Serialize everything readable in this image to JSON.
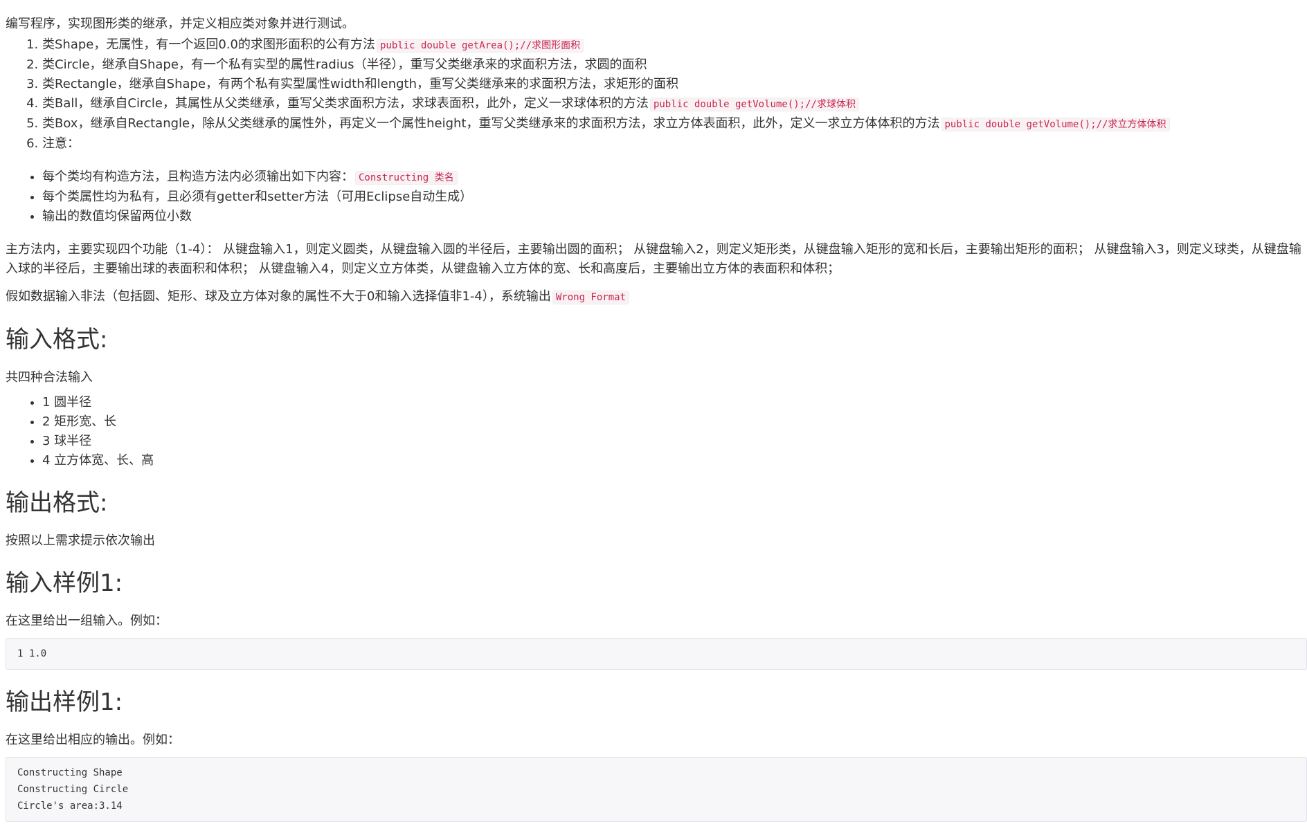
{
  "intro": "编写程序，实现图形类的继承，并定义相应类对象并进行测试。",
  "requirements": [
    {
      "text": "类Shape，无属性，有一个返回0.0的求图形面积的公有方法",
      "code": "public double getArea();//求图形面积"
    },
    {
      "text": "类Circle，继承自Shape，有一个私有实型的属性radius（半径），重写父类继承来的求面积方法，求圆的面积",
      "code": ""
    },
    {
      "text": "类Rectangle，继承自Shape，有两个私有实型属性width和length，重写父类继承来的求面积方法，求矩形的面积",
      "code": ""
    },
    {
      "text": "类Ball，继承自Circle，其属性从父类继承，重写父类求面积方法，求球表面积，此外，定义一求球体积的方法",
      "code": "public double getVolume();//求球体积"
    },
    {
      "text": "类Box，继承自Rectangle，除从父类继承的属性外，再定义一个属性height，重写父类继承来的求面积方法，求立方体表面积，此外，定义一求立方体体积的方法",
      "code": "public double getVolume();//求立方体体积"
    },
    {
      "text": "注意：",
      "code": ""
    }
  ],
  "notes": [
    {
      "text": "每个类均有构造方法，且构造方法内必须输出如下内容：",
      "code": "Constructing 类名"
    },
    {
      "text": "每个类属性均为私有，且必须有getter和setter方法（可用Eclipse自动生成）",
      "code": ""
    },
    {
      "text": "输出的数值均保留两位小数",
      "code": ""
    }
  ],
  "main_paragraph": "主方法内，主要实现四个功能（1-4）： 从键盘输入1，则定义圆类，从键盘输入圆的半径后，主要输出圆的面积； 从键盘输入2，则定义矩形类，从键盘输入矩形的宽和长后，主要输出矩形的面积； 从键盘输入3，则定义球类，从键盘输入球的半径后，主要输出球的表面积和体积； 从键盘输入4，则定义立方体类，从键盘输入立方体的宽、长和高度后，主要输出立方体的表面积和体积；",
  "wrong_paragraph": {
    "text": "假如数据输入非法（包括圆、矩形、球及立方体对象的属性不大于0和输入选择值非1-4），系统输出",
    "code": "Wrong Format"
  },
  "input_format": {
    "heading": "输入格式:",
    "text": "共四种合法输入",
    "items": [
      "1 圆半径",
      "2 矩形宽、长",
      "3 球半径",
      "4 立方体宽、长、高"
    ]
  },
  "output_format": {
    "heading": "输出格式:",
    "text": "按照以上需求提示依次输出"
  },
  "input_sample": {
    "heading": "输入样例1:",
    "text": "在这里给出一组输入。例如：",
    "lines": [
      "1 1.0"
    ]
  },
  "output_sample": {
    "heading": "输出样例1:",
    "text": "在这里给出相应的输出。例如：",
    "lines": [
      "Constructing Shape",
      "Constructing Circle",
      "Circle's area:3.14"
    ]
  }
}
